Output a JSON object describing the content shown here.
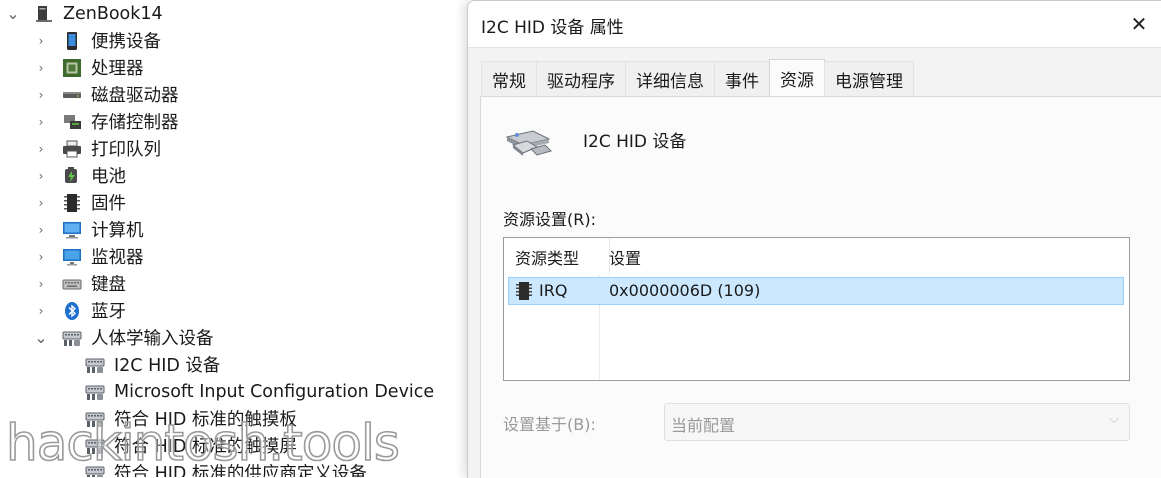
{
  "tree": {
    "items": [
      {
        "label": "ZenBook14",
        "icon": "computer-tower-icon",
        "expanded": true,
        "level": 0
      },
      {
        "label": "便携设备",
        "icon": "portable-device-icon",
        "level": 1
      },
      {
        "label": "处理器",
        "icon": "processor-icon",
        "level": 1
      },
      {
        "label": "磁盘驱动器",
        "icon": "disk-drive-icon",
        "level": 1
      },
      {
        "label": "存储控制器",
        "icon": "storage-controller-icon",
        "level": 1
      },
      {
        "label": "打印队列",
        "icon": "printer-icon",
        "level": 1
      },
      {
        "label": "电池",
        "icon": "battery-icon",
        "level": 1
      },
      {
        "label": "固件",
        "icon": "firmware-icon",
        "level": 1
      },
      {
        "label": "计算机",
        "icon": "computer-icon",
        "level": 1
      },
      {
        "label": "监视器",
        "icon": "monitor-icon",
        "level": 1
      },
      {
        "label": "键盘",
        "icon": "keyboard-icon",
        "level": 1
      },
      {
        "label": "蓝牙",
        "icon": "bluetooth-icon",
        "level": 1
      },
      {
        "label": "人体学输入设备",
        "icon": "hid-icon",
        "expanded": true,
        "level": 1
      },
      {
        "label": "I2C HID 设备",
        "icon": "hid-icon",
        "level": 2
      },
      {
        "label": "Microsoft Input Configuration Device",
        "icon": "hid-icon",
        "level": 2
      },
      {
        "label": "符合 HID 标准的触摸板",
        "icon": "hid-icon",
        "level": 2
      },
      {
        "label": "符合 HID 标准的触摸屏",
        "icon": "hid-icon",
        "level": 2
      },
      {
        "label": "符合 HID 标准的供应商定义设备",
        "icon": "hid-icon",
        "level": 2
      }
    ]
  },
  "watermark": "hackintosh.tools",
  "dialog": {
    "title": "I2C HID 设备 属性",
    "close_glyph": "✕",
    "tabs": [
      {
        "label": "常规"
      },
      {
        "label": "驱动程序"
      },
      {
        "label": "详细信息"
      },
      {
        "label": "事件"
      },
      {
        "label": "资源",
        "active": true
      },
      {
        "label": "电源管理"
      }
    ],
    "device_name": "I2C HID 设备",
    "device_icon": "hid-device-icon",
    "resources_label": "资源设置(R):",
    "columns": {
      "type": "资源类型",
      "setting": "设置"
    },
    "rows": [
      {
        "type": "IRQ",
        "setting": "0x0000006D (109)",
        "icon": "chip-icon",
        "selected": true
      }
    ],
    "basis_label": "设置基于(B):",
    "basis_value": "当前配置"
  },
  "colors": {
    "selection_bg": "#cce8ff",
    "selection_border": "#99d1ff",
    "accent_blue": "#0078d4"
  }
}
